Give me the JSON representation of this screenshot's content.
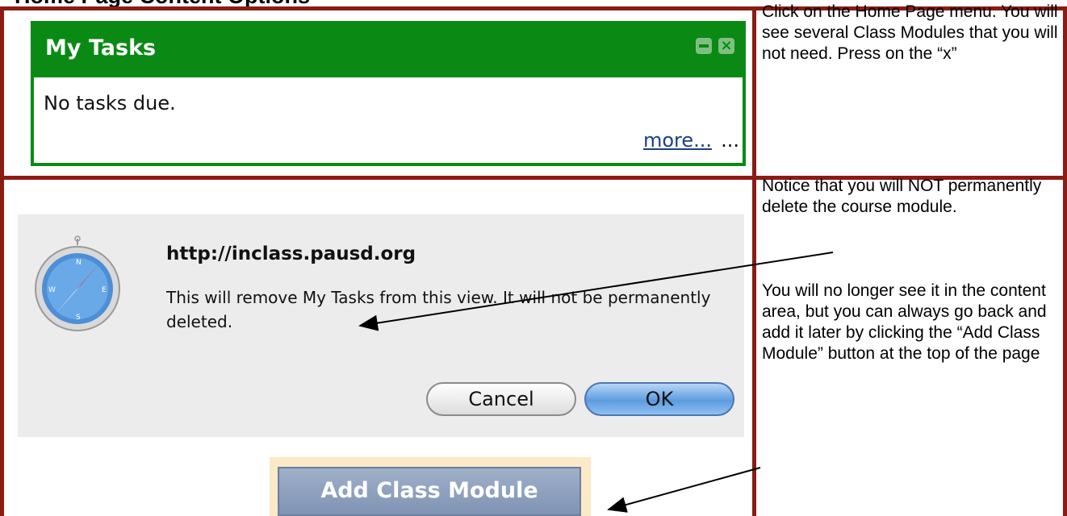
{
  "page": {
    "heading": "Home Page Content Options"
  },
  "widget": {
    "title": "My Tasks",
    "minimize_icon": "minimize-icon",
    "close_label": "×",
    "body_text": "No tasks due.",
    "more_link": "more...",
    "more_trail": "..."
  },
  "instructions": {
    "top": "Click on the Home Page menu. You will see several Class Modules that you will not need. Press on the “x”",
    "bottom_1": "Notice that you will NOT permanently delete the course module.",
    "bottom_2": "You will no longer see it in the content area, but you can always go back and add it later by clicking the “Add Class Module” button at the top of the page"
  },
  "dialog": {
    "icon": "safari-compass-icon",
    "title": "http://inclass.pausd.org",
    "message": "This will remove My Tasks from this view. It will not be permanently deleted.",
    "cancel_label": "Cancel",
    "ok_label": "OK"
  },
  "add_button": {
    "label": "Add Class Module"
  },
  "colors": {
    "border": "#8b1c13",
    "widget_green": "#0a8a14",
    "link": "#1b3f86"
  }
}
